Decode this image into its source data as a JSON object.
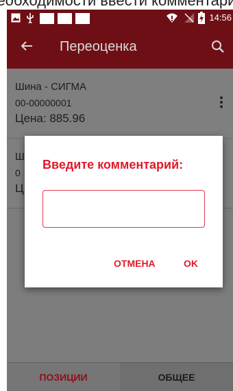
{
  "caption": {
    "text": "необходимости ввести комментарий"
  },
  "status_bar": {
    "time": "14:56",
    "icons": [
      "image-icon",
      "usb-icon",
      "white-square-icon",
      "white-square-icon",
      "white-square-icon",
      "wifi-icon",
      "no-signal-icon",
      "battery-charging-icon"
    ]
  },
  "toolbar": {
    "title": "Переоценка",
    "back_icon": "arrow-left-icon",
    "search_icon": "search-icon"
  },
  "list": {
    "items": [
      {
        "name": "Шина - СИГМА",
        "code": "00-00000001",
        "price": "Цена: 885.96"
      },
      {
        "name": "Ш",
        "code": "0",
        "price": "Ц"
      }
    ]
  },
  "dialog": {
    "title": "Введите комментарий:",
    "input_value": "",
    "cancel_label": "ОТМЕНА",
    "ok_label": "OK"
  },
  "tabs": [
    {
      "label": "ПОЗИЦИИ",
      "active": true
    },
    {
      "label": "ОБЩЕЕ",
      "active": false
    }
  ],
  "colors": {
    "toolbar": "#6e0f16",
    "accent": "#e01a2c",
    "dim_overlay": "#7f7f7f"
  }
}
